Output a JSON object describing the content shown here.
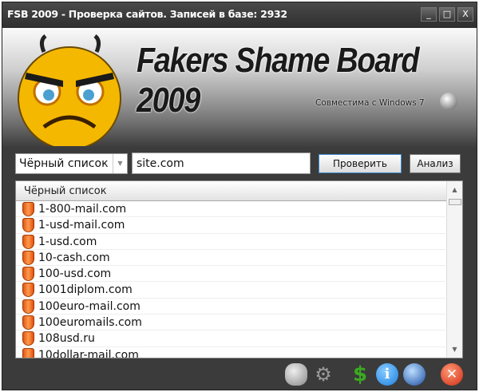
{
  "window": {
    "title": "FSB 2009 - Проверка сайтов. Записей в базе: 2932",
    "minimize": "_",
    "maximize": "□",
    "close": "X"
  },
  "header": {
    "logo_text": "Fakers Shame Board 2009",
    "compat": "Совместима с Windows 7"
  },
  "controls": {
    "list_select": "Чёрный список",
    "url_value": "site.com",
    "check_button": "Проверить",
    "analyze_button": "Анализ"
  },
  "list": {
    "column": "Чёрный список",
    "items": [
      "1-800-mail.com",
      "1-usd-mail.com",
      "1-usd.com",
      "10-cash.com",
      "100-usd.com",
      "1001diplom.com",
      "100euro-mail.com",
      "100euromails.com",
      "108usd.ru",
      "10dollar-mail.com"
    ]
  },
  "toolbar": {
    "icons": [
      "database-refresh-icon",
      "settings-gears-icon",
      "update-arrows-icon",
      "info-icon",
      "globe-icon",
      "exit-icon"
    ]
  },
  "colors": {
    "accent_orange": "#f07020",
    "info_blue": "#1a7ee0",
    "close_red": "#e03a1a",
    "update_green": "#3aaa20"
  }
}
